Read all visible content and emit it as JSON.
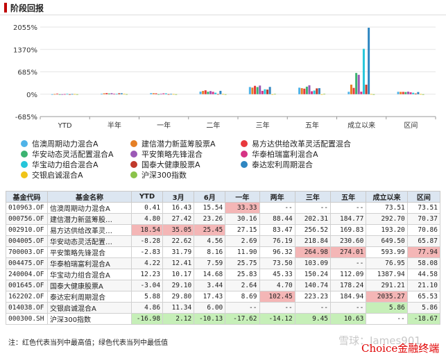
{
  "header": {
    "title": "阶段回报"
  },
  "chart_data": {
    "type": "bar",
    "categories": [
      "YTD",
      "半年",
      "一年",
      "二年",
      "三年",
      "五年",
      "成立以来",
      "区间"
    ],
    "y_ticks": [
      "-685%",
      "0%",
      "685%",
      "1370%",
      "2055%"
    ],
    "ylim": [
      -685,
      2055
    ],
    "series": [
      {
        "name": "信澳周期动力混合A",
        "color": "#4fb3e8",
        "values": [
          0.41,
          16.43,
          33.33,
          80,
          220,
          200,
          73.51,
          73.51
        ]
      },
      {
        "name": "建信潜力新蓝筹股票A",
        "color": "#e57f25",
        "values": [
          4.8,
          27.42,
          30.16,
          100,
          202.31,
          184.77,
          292.7,
          70.37
        ]
      },
      {
        "name": "易方达供给改革灵活配置混合",
        "color": "#e8383d",
        "values": [
          18.54,
          35.05,
          27.15,
          120,
          256.52,
          169.83,
          193.2,
          70.86
        ]
      },
      {
        "name": "华安动态灵活配置混合A",
        "color": "#3cb371",
        "values": [
          -8.28,
          22.62,
          2.69,
          76,
          218.84,
          230.6,
          649.5,
          65.87
        ]
      },
      {
        "name": "平安策略先锋混合",
        "color": "#9b59b6",
        "values": [
          -2.83,
          31.79,
          11.9,
          96.32,
          264.98,
          274.01,
          593.99,
          77.94
        ]
      },
      {
        "name": "华泰柏瑞富利混合A",
        "color": "#d63384",
        "values": [
          4.22,
          12.41,
          25.75,
          73.5,
          103.09,
          90,
          76.95,
          58.08
        ]
      },
      {
        "name": "华宝动力组合混合A",
        "color": "#26c6da",
        "values": [
          12.23,
          10.17,
          25.83,
          45.33,
          150.24,
          112.09,
          1387.94,
          44.58
        ]
      },
      {
        "name": "国泰大健康股票A",
        "color": "#c0392b",
        "values": [
          -3.04,
          29.1,
          2.64,
          4.7,
          140.74,
          178.24,
          291.21,
          21.1
        ]
      },
      {
        "name": "泰达宏利周期混合",
        "color": "#2e86c1",
        "values": [
          5.88,
          29.8,
          8.69,
          102.45,
          223.23,
          184.94,
          2035.27,
          65.53
        ]
      },
      {
        "name": "交银启诚混合A",
        "color": "#f0c419",
        "values": [
          4.86,
          11.34,
          6.0,
          8,
          0,
          0,
          5.86,
          5.86
        ]
      },
      {
        "name": "沪深300指数",
        "color": "#8bc34a",
        "values": [
          -16.98,
          2.12,
          -17.62,
          -14.12,
          9.45,
          10.63,
          -18.67,
          -18.67
        ]
      }
    ]
  },
  "table": {
    "headers": [
      "基金代码",
      "基金名称",
      "YTD",
      "3月",
      "6月",
      "一年",
      "两年",
      "三年",
      "五年",
      "成立以来",
      "区间"
    ],
    "rows": [
      {
        "cells": [
          "010963.OF",
          "信澳周期动力混合A",
          "0.41",
          "16.43",
          "15.54",
          "33.33",
          "--",
          "--",
          "--",
          "73.51",
          "73.51"
        ],
        "max": [
          5
        ],
        "min": []
      },
      {
        "cells": [
          "000756.OF",
          "建信潜力新蓝筹股…",
          "4.80",
          "27.42",
          "23.26",
          "30.16",
          "88.44",
          "202.31",
          "184.77",
          "292.70",
          "70.37"
        ],
        "max": [],
        "min": []
      },
      {
        "cells": [
          "002910.OF",
          "易方达供给改革灵…",
          "18.54",
          "35.05",
          "25.45",
          "27.15",
          "83.47",
          "256.52",
          "169.83",
          "193.20",
          "70.86"
        ],
        "max": [
          2,
          3,
          4
        ],
        "min": []
      },
      {
        "cells": [
          "004005.OF",
          "华安动态灵活配置…",
          "-8.28",
          "22.62",
          "4.56",
          "2.69",
          "76.19",
          "218.84",
          "230.60",
          "649.50",
          "65.87"
        ],
        "max": [],
        "min": []
      },
      {
        "cells": [
          "700003.OF",
          "平安策略先锋混合",
          "-2.83",
          "31.79",
          "8.16",
          "11.90",
          "96.32",
          "264.98",
          "274.01",
          "593.99",
          "77.94"
        ],
        "max": [
          7,
          8,
          10
        ],
        "min": []
      },
      {
        "cells": [
          "004475.OF",
          "华泰柏瑞富利混合A",
          "4.22",
          "12.41",
          "7.59",
          "25.75",
          "73.50",
          "103.09",
          "--",
          "76.95",
          "58.08"
        ],
        "max": [],
        "min": []
      },
      {
        "cells": [
          "240004.OF",
          "华宝动力组合混合A",
          "12.23",
          "10.17",
          "14.68",
          "25.83",
          "45.33",
          "150.24",
          "112.09",
          "1387.94",
          "44.58"
        ],
        "max": [],
        "min": []
      },
      {
        "cells": [
          "001645.OF",
          "国泰大健康股票A",
          "-3.04",
          "29.10",
          "3.44",
          "2.64",
          "4.70",
          "140.74",
          "178.24",
          "291.21",
          "21.10"
        ],
        "max": [],
        "min": []
      },
      {
        "cells": [
          "162202.OF",
          "泰达宏利周期混合",
          "5.88",
          "29.80",
          "17.43",
          "8.69",
          "102.45",
          "223.23",
          "184.94",
          "2035.27",
          "65.53"
        ],
        "max": [
          6,
          9
        ],
        "min": []
      },
      {
        "cells": [
          "014038.OF",
          "交银启诚混合A",
          "4.86",
          "11.34",
          "6.00",
          "--",
          "--",
          "--",
          "--",
          "5.86",
          "5.86"
        ],
        "max": [],
        "min": [
          9
        ]
      },
      {
        "cells": [
          "000300.SH",
          "沪深300指数",
          "-16.98",
          "2.12",
          "-10.13",
          "-17.62",
          "-14.12",
          "9.45",
          "10.63",
          "--",
          "-18.67"
        ],
        "max": [],
        "min": [
          2,
          3,
          4,
          5,
          6,
          7,
          8,
          10
        ]
      }
    ]
  },
  "note": "注：红色代表当列中最高值；绿色代表当列中最低值",
  "watermark": "雪球：James901",
  "brand": "Choice金融终端"
}
